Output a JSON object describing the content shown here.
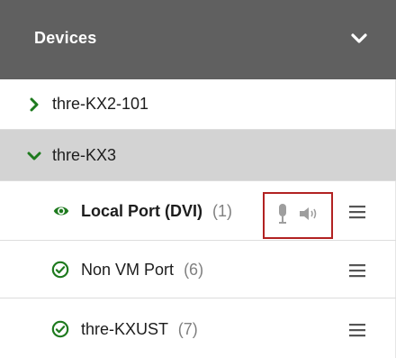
{
  "header": {
    "title": "Devices"
  },
  "tree": {
    "groups": [
      {
        "label": "thre-KX2-101"
      },
      {
        "label": "thre-KX3"
      }
    ],
    "ports": [
      {
        "label": "Local Port (DVI)",
        "count": "(1)"
      },
      {
        "label": "Non VM Port",
        "count": "(6)"
      },
      {
        "label": "thre-KXUST",
        "count": "(7)"
      }
    ]
  },
  "colors": {
    "header_bg": "#606060",
    "accent_green": "#1e7a1e",
    "selected_bg": "#d3d3d3",
    "highlight_border": "#b22222"
  },
  "icons": {
    "collapse": "chevron-down-icon",
    "expand": "chevron-right-icon",
    "active_port": "eye-icon",
    "port_status": "check-circle-icon",
    "audio_in": "microphone-icon",
    "audio_out": "speaker-icon",
    "row_menu": "hamburger-menu-icon"
  }
}
